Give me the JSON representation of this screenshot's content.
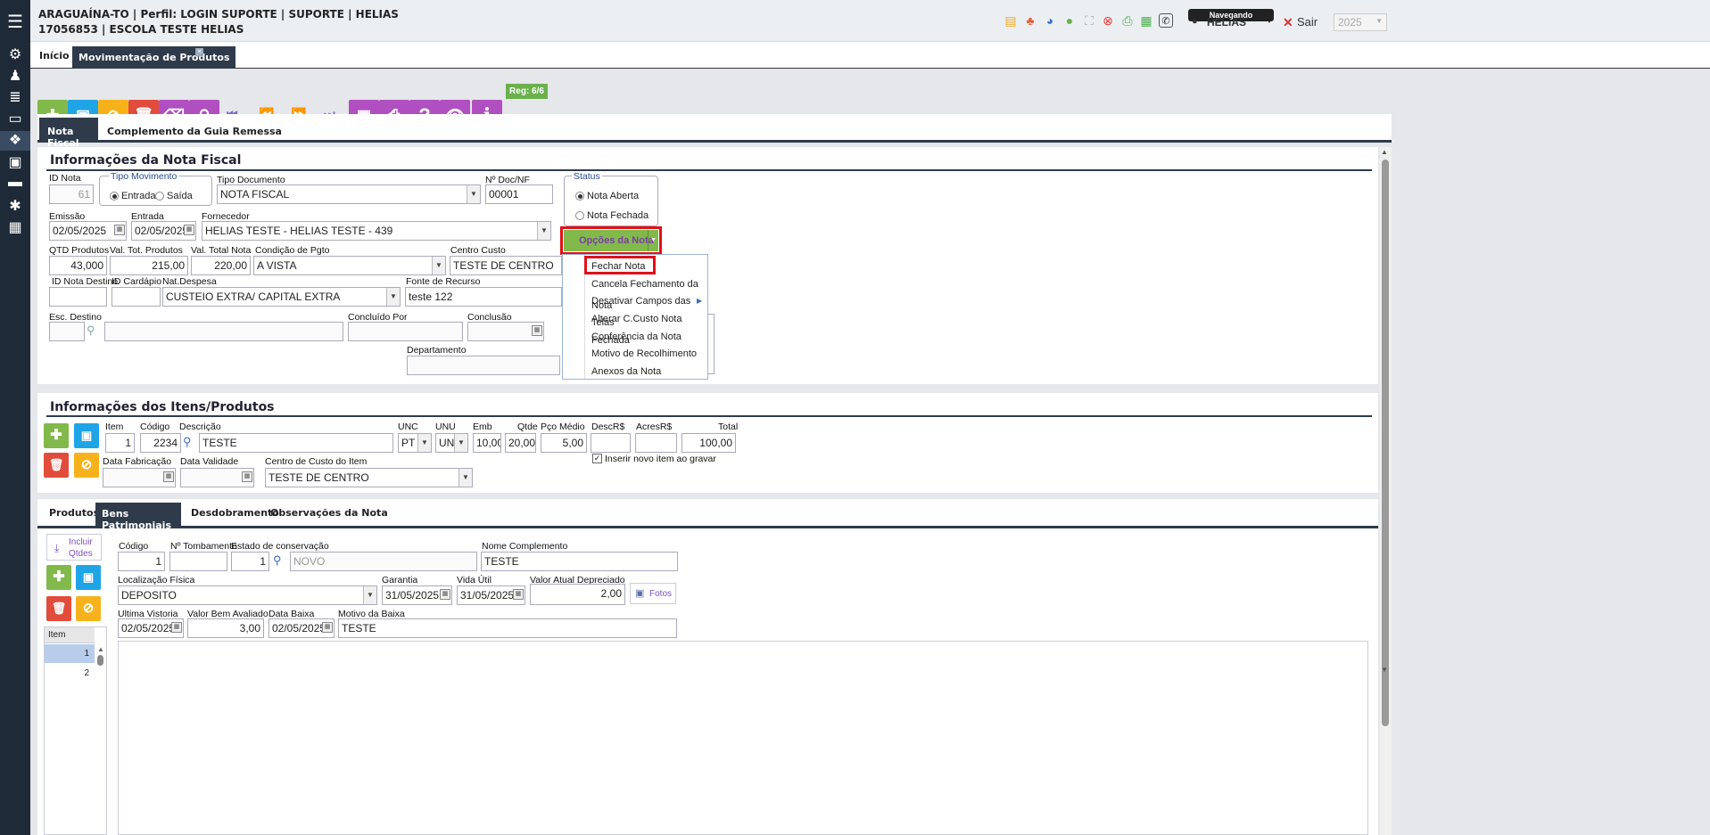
{
  "header": {
    "line1": "ARAGUAÍNA-TO | Perfil: LOGIN SUPORTE | SUPORTE | HELIAS",
    "line2": "17056853 | ESCOLA TESTE HELIAS",
    "user": "HELIAS",
    "user_badge": "Navegando",
    "exit": "Sair",
    "year": "2025"
  },
  "tabs": {
    "home": "Início",
    "current": "Movimentação de Produtos"
  },
  "toolbar": {
    "reg": "Reg: 6/6"
  },
  "note_tabs": {
    "fiscal": "Nota Fiscal",
    "guia": "Complemento da Guia Remessa"
  },
  "nf": {
    "section": "Informações da Nota Fiscal",
    "id_nota_label": "ID Nota",
    "id_nota": "61",
    "tipo_mov_label": "Tipo Movimento",
    "entrada": "Entrada",
    "saida": "Saída",
    "tipo_doc_label": "Tipo Documento",
    "tipo_doc": "NOTA FISCAL",
    "ndoc_label": "Nº Doc/NF",
    "ndoc": "00001",
    "status_label": "Status",
    "aberta": "Nota Aberta",
    "fechada": "Nota Fechada",
    "emissao_label": "Emissão",
    "emissao": "02/05/2025",
    "entrada_label": "Entrada",
    "entrada_data": "02/05/2025",
    "fornecedor_label": "Fornecedor",
    "fornecedor": "HELIAS TESTE - HELIAS TESTE - 439",
    "qtd_label": "QTD Produtos",
    "qtd": "43,000",
    "valtot_label": "Val. Tot. Produtos",
    "valtot": "215,00",
    "valnota_label": "Val. Total Nota",
    "valnota": "220,00",
    "cond_label": "Condição de Pgto",
    "cond": "A  VISTA",
    "ccusto_label": "Centro Custo",
    "ccusto": "TESTE DE CENTRO",
    "idnd_label": "ID Nota Destino",
    "idcard_label": "ID Cardápio",
    "natdesp_label": "Nat.Despesa",
    "natdesp": "CUSTEIO EXTRA/ CAPITAL EXTRA",
    "fonte_label": "Fonte de Recurso",
    "fonte": "teste 122",
    "escdest_label": "Esc. Destino",
    "concpor_label": "Concluído Por",
    "conclusao_label": "Conclusão",
    "depto_label": "Departamento"
  },
  "options": {
    "button": "Opções da Nota",
    "items": [
      "Fechar Nota",
      "Cancela Fechamento da Nota",
      "Desativar Campos das Telas",
      "Alterar C.Custo Nota Fechada",
      "Conferência da Nota",
      "Motivo de Recolhimento",
      "Anexos da Nota"
    ]
  },
  "itens": {
    "section": "Informações dos Itens/Produtos",
    "item_label": "Item",
    "item": "1",
    "cod_label": "Código",
    "cod": "2234",
    "desc_label": "Descrição",
    "desc": "TESTE",
    "unc_label": "UNC",
    "unc": "PT",
    "unu_label": "UNU",
    "unu": "UN",
    "emb_label": "Emb",
    "emb": "10,00",
    "qtde_label": "Qtde",
    "qtde": "20,00",
    "pco_label": "Pço Médio",
    "pco": "5,00",
    "descr_label": "DescR$",
    "acres_label": "AcresR$",
    "total_label": "Total",
    "total": "100,00",
    "fab_label": "Data Fabricação",
    "val_label": "Data Validade",
    "cc_label": "Centro de Custo do Item",
    "cc": "TESTE DE CENTRO",
    "novo_item": "Inserir novo item ao gravar"
  },
  "bottom_tabs": [
    "Produtos",
    "Bens Patrimoniais",
    "Desdobramento",
    "Observações da Nota"
  ],
  "bens": {
    "incluir": "Incluir",
    "qtdes": "Qtdes",
    "cod_label": "Código",
    "cod": "1",
    "tomb_label": "Nº Tombamento",
    "estado_label": "Estado de conservação",
    "estado_id": "1",
    "estado": "NOVO",
    "nome_label": "Nome Complemento",
    "nome": "TESTE",
    "loc_label": "Localização Física",
    "loc": "DEPOSITO",
    "gar_label": "Garantia",
    "gar": "31/05/2025",
    "vida_label": "Vida Útil",
    "vida": "31/05/2025",
    "vad_label": "Valor Atual Depreciado",
    "vad": "2,00",
    "fotos": "Fotos",
    "ult_label": "Ultima Vistoria",
    "ult": "02/05/2025",
    "vba_label": "Valor Bem Avaliado",
    "vba": "3,00",
    "dbaixa_label": "Data Baixa",
    "dbaixa": "02/05/2025",
    "motivo_label": "Motivo da Baixa",
    "motivo": "TESTE",
    "grid_header": "Item",
    "grid_rows": [
      "1",
      "2"
    ]
  },
  "colors": {
    "green": "#82b94b",
    "blue": "#1fa4e6",
    "yellow": "#f7b21b",
    "red": "#e14c3c",
    "purple": "#b04fc0",
    "highlight": "#e0101a"
  }
}
